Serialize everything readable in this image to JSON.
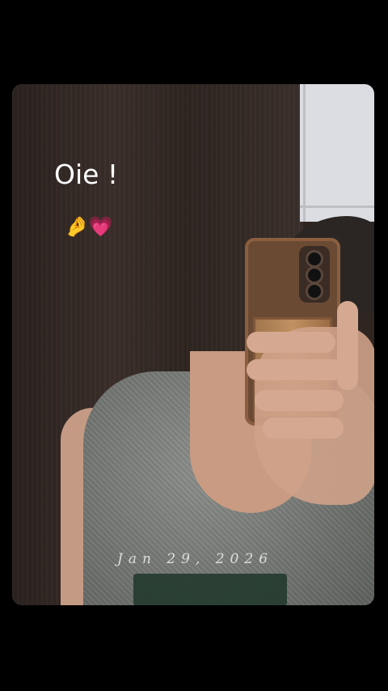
{
  "story": {
    "caption_text": "Oie !",
    "emoji_text": "🤌💗",
    "date_stamp": "Jan 29, 2026"
  },
  "colors": {
    "background": "#000000",
    "caption": "#ffffff"
  }
}
